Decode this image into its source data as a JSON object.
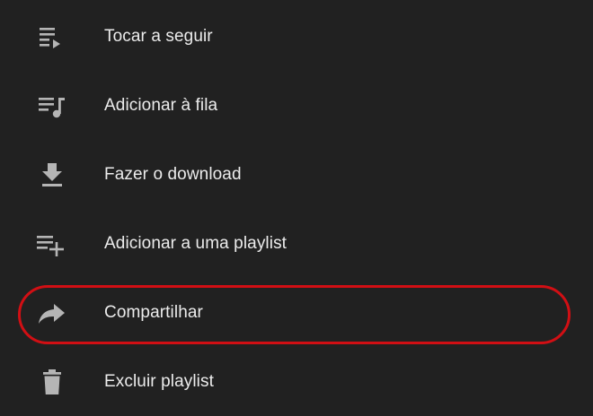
{
  "menu": {
    "items": [
      {
        "label": "Tocar a seguir",
        "icon": "play-next-icon"
      },
      {
        "label": "Adicionar à fila",
        "icon": "queue-music-icon"
      },
      {
        "label": "Fazer o download",
        "icon": "download-icon"
      },
      {
        "label": "Adicionar a uma playlist",
        "icon": "playlist-add-icon"
      },
      {
        "label": "Compartilhar",
        "icon": "share-icon"
      },
      {
        "label": "Excluir playlist",
        "icon": "trash-icon"
      }
    ]
  },
  "colors": {
    "background": "#212121",
    "text": "#ececec",
    "icon": "#b5b5b5",
    "highlight": "#d10f14"
  }
}
